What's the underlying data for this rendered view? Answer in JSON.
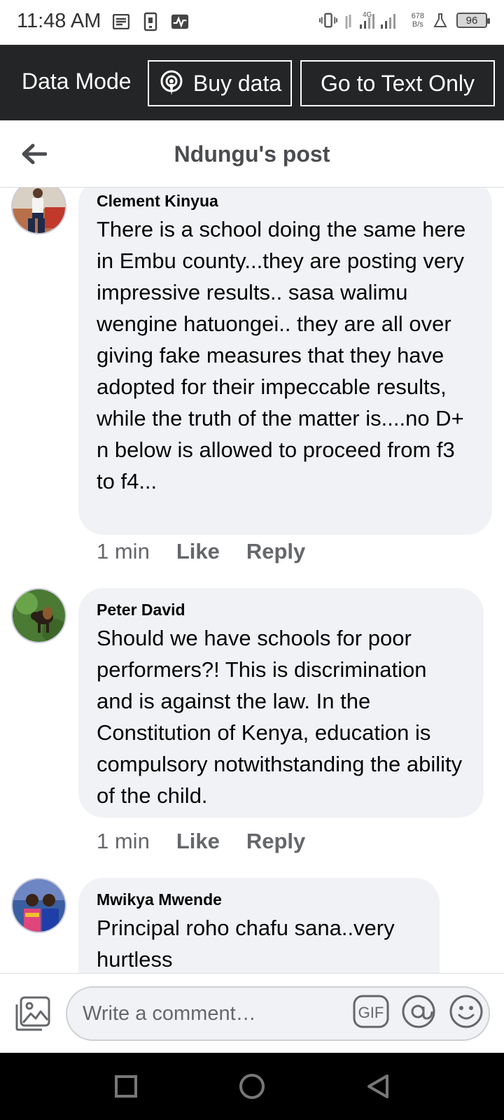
{
  "status_bar": {
    "time": "11:48 AM",
    "network_type": "4G",
    "speed_value": "678",
    "speed_unit": "B/s",
    "battery": "96"
  },
  "data_bar": {
    "mode_label": "Data Mode",
    "buy_label": "Buy data",
    "text_only_label": "Go to Text Only"
  },
  "header": {
    "title": "Ndungu's post"
  },
  "comments": [
    {
      "author": "Clement Kinyua",
      "text": "There is a school doing the same here in Embu county...they are posting very impressive results.. sasa walimu wengine hatuongei.. they are all over giving fake measures that they have adopted for their impeccable results, while the truth of the matter is....no D+ n below is allowed to proceed from f3 to f4...",
      "time": "1 min",
      "like": "Like",
      "reply": "Reply"
    },
    {
      "author": "Peter David",
      "text": "Should we have schools for poor performers?! This is discrimination and is against the law. In the Constitution of Kenya, education is compulsory notwithstanding the ability of the child.",
      "time": "1 min",
      "like": "Like",
      "reply": "Reply"
    },
    {
      "author": "Mwikya Mwende",
      "text": "Principal roho chafu sana..very hurtless"
    }
  ],
  "composer": {
    "placeholder": "Write a comment…",
    "gif_label": "GIF"
  },
  "colors": {
    "dark_bar": "#242526",
    "bubble": "#f0f2f5",
    "meta": "#65676b",
    "title": "#4b4c4f"
  }
}
